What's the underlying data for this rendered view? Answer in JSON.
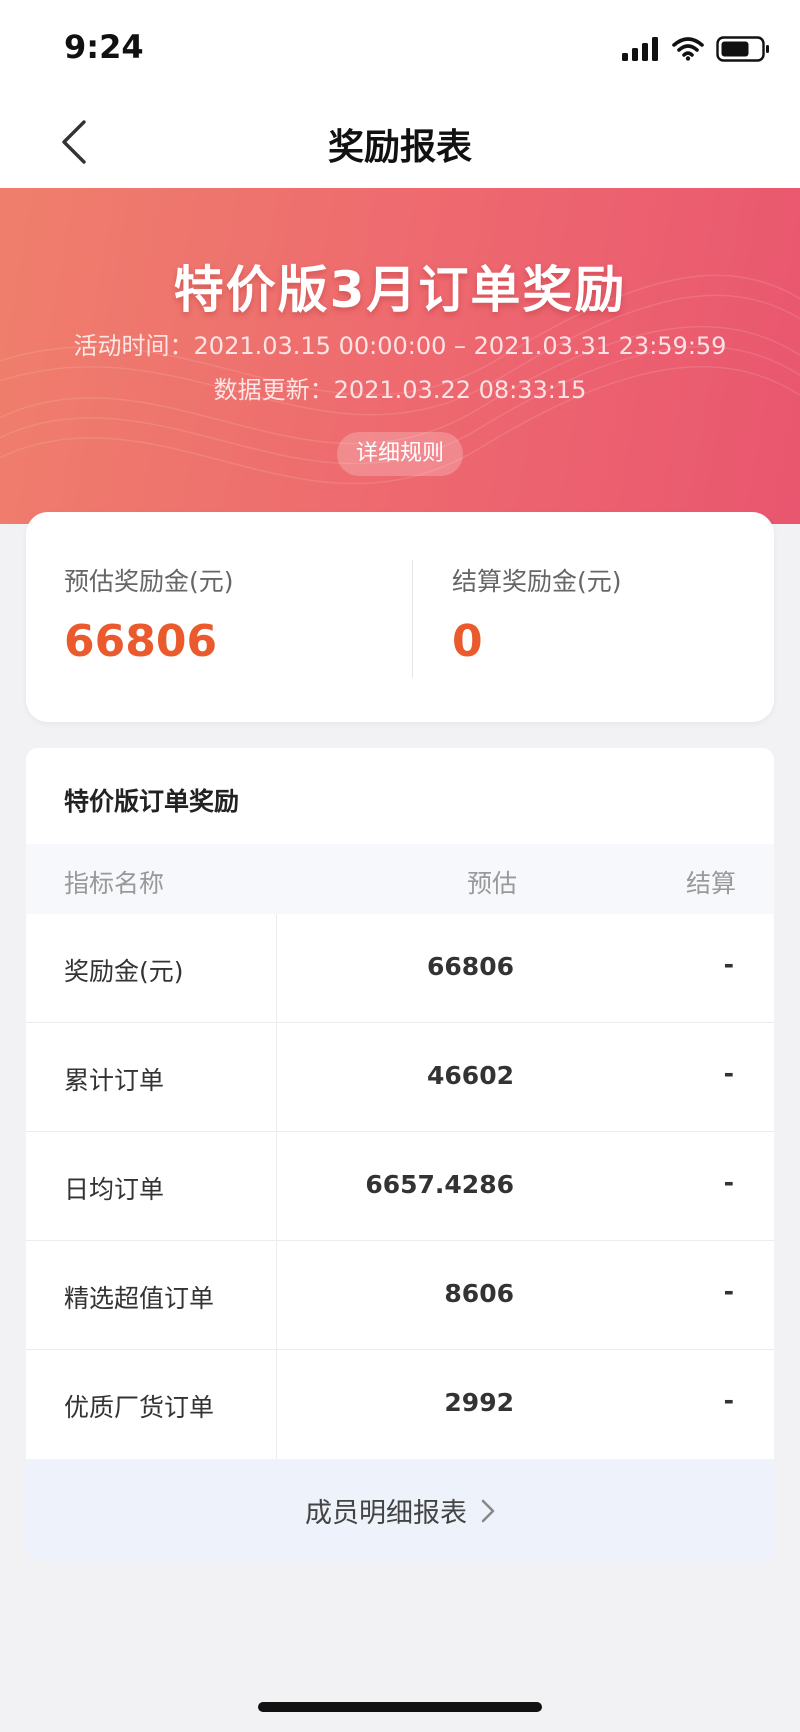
{
  "status_bar": {
    "time": "9:24",
    "icons": [
      "signal-icon",
      "wifi-icon",
      "battery-icon"
    ]
  },
  "nav": {
    "title": "奖励报表",
    "back_icon": "chevron-left-icon"
  },
  "hero": {
    "title": "特价版3月订单奖励",
    "activity_time": "活动时间：2021.03.15 00:00:00 – 2021.03.31 23:59:59",
    "data_update": "数据更新：2021.03.22 08:33:15",
    "rules_button": "详细规则"
  },
  "summary": {
    "estimated_label": "预估奖励金(元)",
    "estimated_value": "66806",
    "settled_label": "结算奖励金(元)",
    "settled_value": "0"
  },
  "report": {
    "title": "特价版订单奖励",
    "headers": {
      "name": "指标名称",
      "estimated": "预估",
      "settled": "结算"
    },
    "rows": [
      {
        "name": "奖励金(元)",
        "estimated": "66806",
        "settled": "-"
      },
      {
        "name": "累计订单",
        "estimated": "46602",
        "settled": "-"
      },
      {
        "name": "日均订单",
        "estimated": "6657.4286",
        "settled": "-"
      },
      {
        "name": "精选超值订单",
        "estimated": "8606",
        "settled": "-"
      },
      {
        "name": "优质厂货订单",
        "estimated": "2992",
        "settled": "-"
      }
    ],
    "member_link": "成员明细报表"
  },
  "colors": {
    "accent_orange": "#ea5a2c",
    "hero_gradient_start": "#ef7f6c",
    "hero_gradient_end": "#e9566f"
  }
}
